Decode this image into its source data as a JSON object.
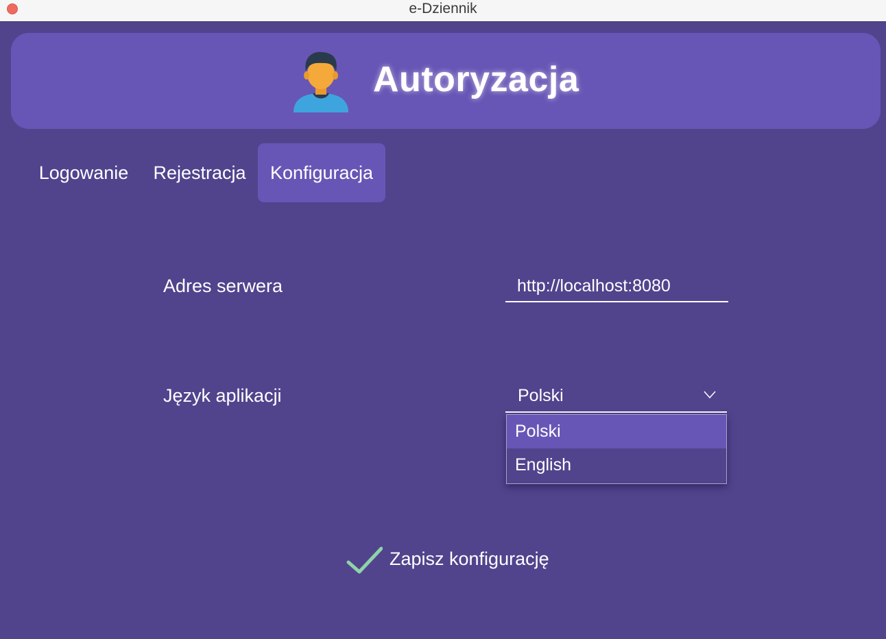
{
  "window": {
    "title": "e-Dziennik"
  },
  "header": {
    "title": "Autoryzacja",
    "icon": "user-avatar-icon"
  },
  "tabs": [
    {
      "label": "Logowanie",
      "active": false
    },
    {
      "label": "Rejestracja",
      "active": false
    },
    {
      "label": "Konfiguracja",
      "active": true
    }
  ],
  "form": {
    "server_label": "Adres serwera",
    "server_value": "http://localhost:8080",
    "language_label": "Język aplikacji",
    "language_value": "Polski",
    "language_options": [
      "Polski",
      "English"
    ],
    "language_selected_index": 0
  },
  "save": {
    "label": "Zapisz konfigurację",
    "icon": "check-icon",
    "icon_color": "#8fd3a8"
  },
  "colors": {
    "background": "#51448d",
    "accent": "#6856b6",
    "close_button": "#ee6a5f"
  }
}
